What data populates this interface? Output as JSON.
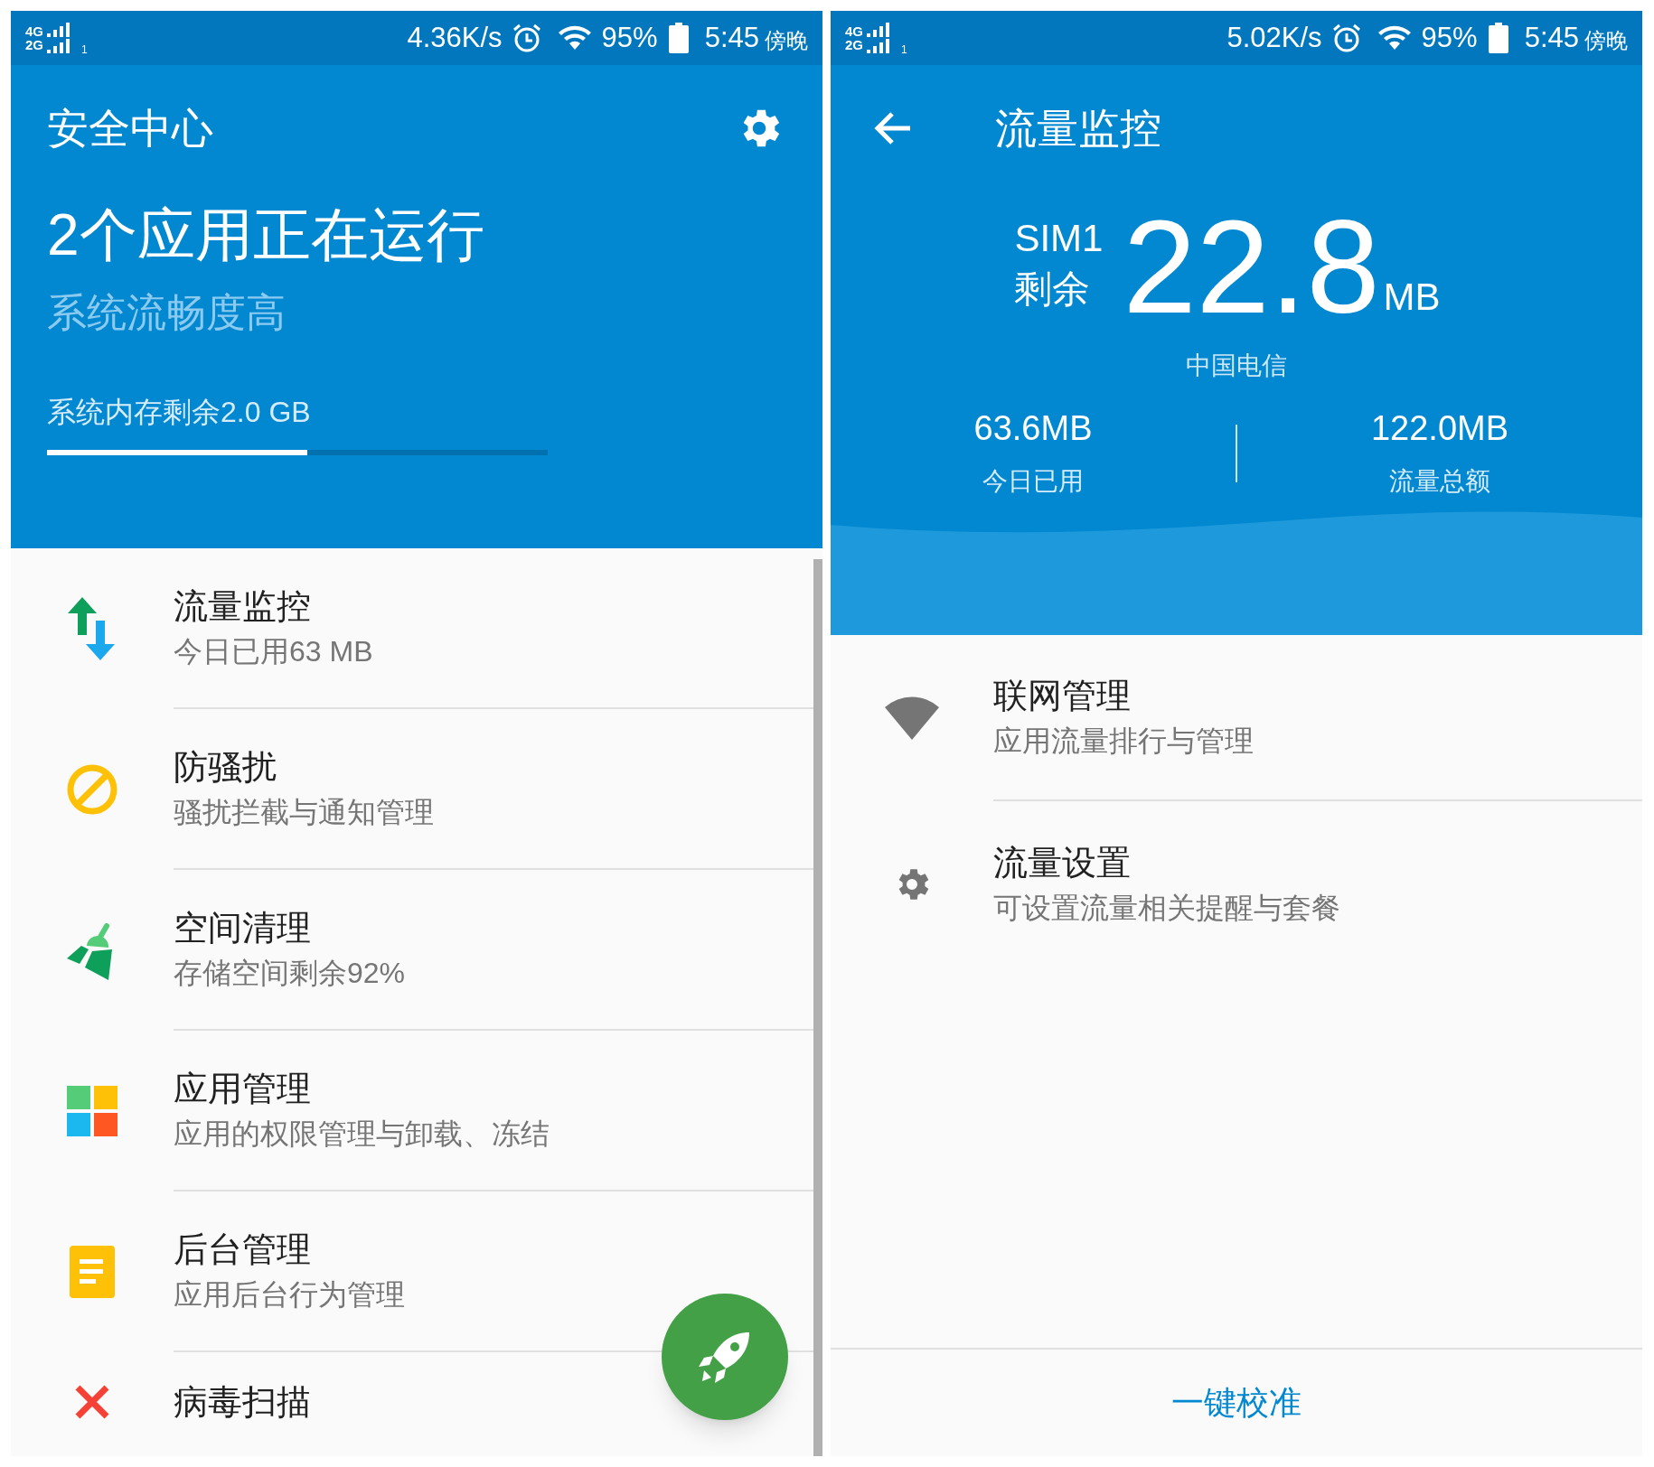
{
  "left_screen": {
    "status_bar": {
      "network_types": [
        "4G",
        "2G"
      ],
      "sim_label": "1",
      "speed": "4.36K/s",
      "battery": "95%",
      "time": "5:45",
      "period": "傍晚"
    },
    "title": "安全中心",
    "headline": "2个应用正在运行",
    "subtitle": "系统流畅度高",
    "memory": {
      "label": "系统内存剩余2.0 GB",
      "level": 0.52
    },
    "items": [
      {
        "kind": "traffic",
        "title": "流量监控",
        "subtitle": "今日已用63 MB"
      },
      {
        "kind": "block",
        "title": "防骚扰",
        "subtitle": "骚扰拦截与通知管理"
      },
      {
        "kind": "broom",
        "title": "空间清理",
        "subtitle": "存储空间剩余92%"
      },
      {
        "kind": "apps",
        "title": "应用管理",
        "subtitle": "应用的权限管理与卸载、冻结"
      },
      {
        "kind": "doc",
        "title": "后台管理",
        "subtitle": "应用后台行为管理"
      },
      {
        "kind": "virus",
        "title": "病毒扫描"
      }
    ]
  },
  "right_screen": {
    "status_bar": {
      "network_types": [
        "4G",
        "2G"
      ],
      "sim_label": "1",
      "speed": "5.02K/s",
      "battery": "95%",
      "time": "5:45",
      "period": "傍晚"
    },
    "title": "流量监控",
    "sim": "SIM1",
    "remaining_label": "剩余",
    "remaining_value": "22.8",
    "remaining_unit": "MB",
    "carrier": "中国电信",
    "stats": [
      {
        "value": "63.6MB",
        "label": "今日已用"
      },
      {
        "value": "122.0MB",
        "label": "流量总额"
      }
    ],
    "items": [
      {
        "kind": "network",
        "title": "联网管理",
        "subtitle": "应用流量排行与管理"
      },
      {
        "kind": "settings",
        "title": "流量设置",
        "subtitle": "可设置流量相关提醒与套餐"
      }
    ],
    "calibrate_link": "一键校准"
  }
}
